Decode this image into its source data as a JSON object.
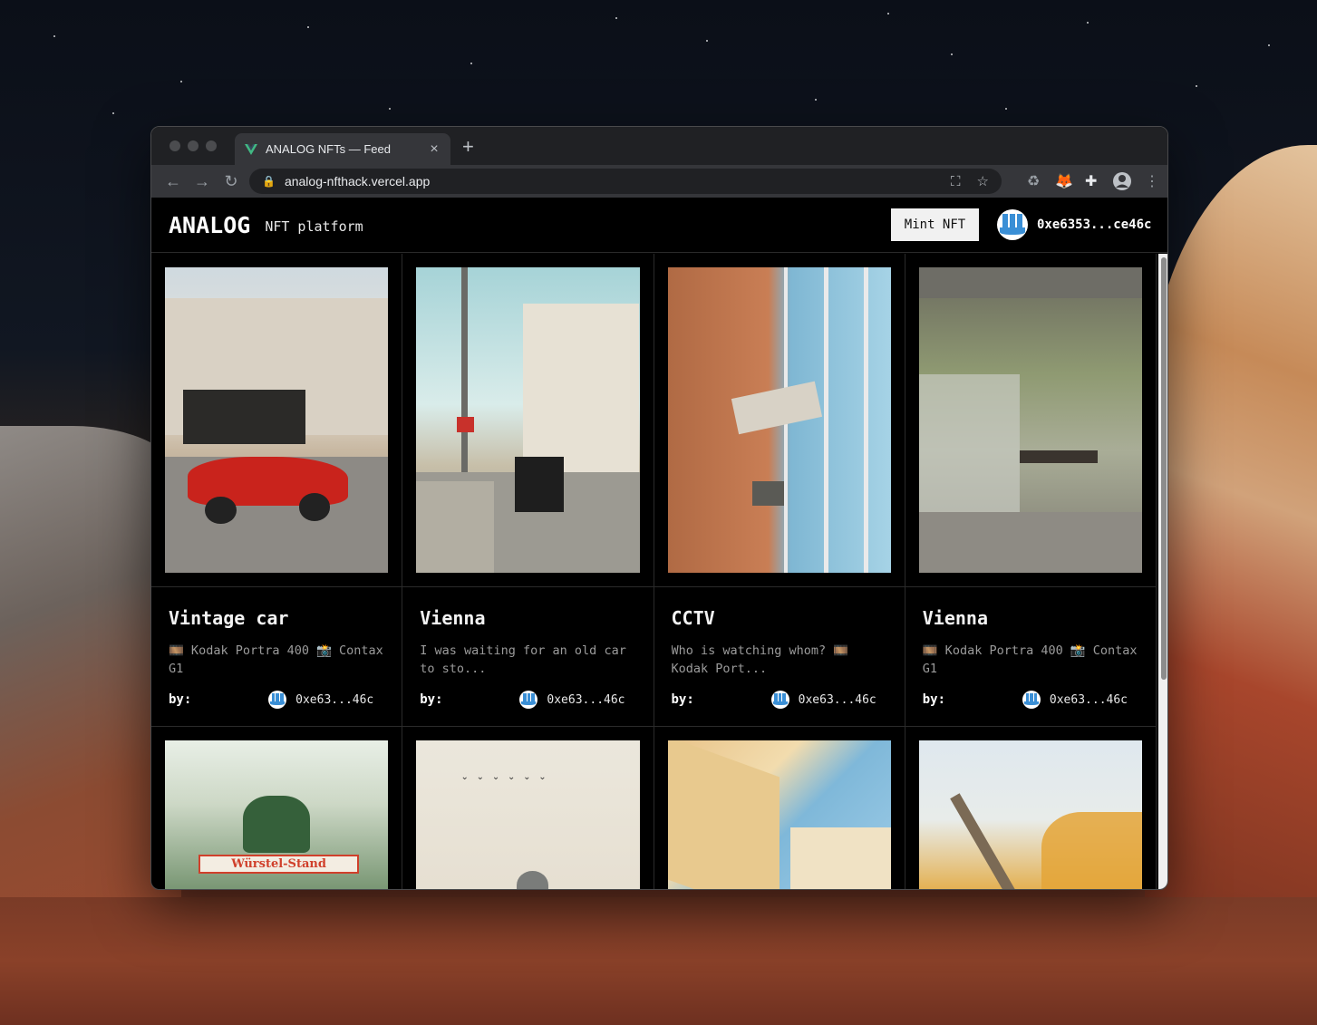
{
  "browser": {
    "tab_title": "ANALOG NFTs — Feed",
    "tab_close": "×",
    "new_tab": "+",
    "url": "analog-nfthack.vercel.app",
    "icons": [
      "back-arrow-icon",
      "forward-arrow-icon",
      "reload-icon",
      "lock-icon",
      "translate-icon",
      "star-icon",
      "recycle-icon",
      "metamask-icon",
      "puzzle-icon",
      "profile-icon",
      "kebab-menu-icon"
    ]
  },
  "header": {
    "logo": "ANALOG",
    "subtitle": "NFT platform",
    "mint_label": "Mint NFT",
    "wallet_address": "0xe6353...ce46c"
  },
  "cards": [
    {
      "title": "Vintage car",
      "description": "🎞️ Kodak Portra 400 📸 Contax G1",
      "by_label": "by:",
      "owner": "0xe63...46c"
    },
    {
      "title": "Vienna",
      "description": "I was waiting for an old car to sto...",
      "by_label": "by:",
      "owner": "0xe63...46c"
    },
    {
      "title": "CCTV",
      "description": "Who is watching whom? 🎞️ Kodak Port...",
      "by_label": "by:",
      "owner": "0xe63...46c"
    },
    {
      "title": "Vienna",
      "description": "🎞️ Kodak Portra 400 📸 Contax G1",
      "by_label": "by:",
      "owner": "0xe63...46c"
    }
  ],
  "second_row_signs": {
    "wurstel_sign": "Würstel-Stand"
  },
  "colors": {
    "accent_avatar": "#3a8fd6",
    "page_bg": "#000000",
    "mint_bg": "#f1f1f1",
    "vue_green": "#41b883"
  }
}
